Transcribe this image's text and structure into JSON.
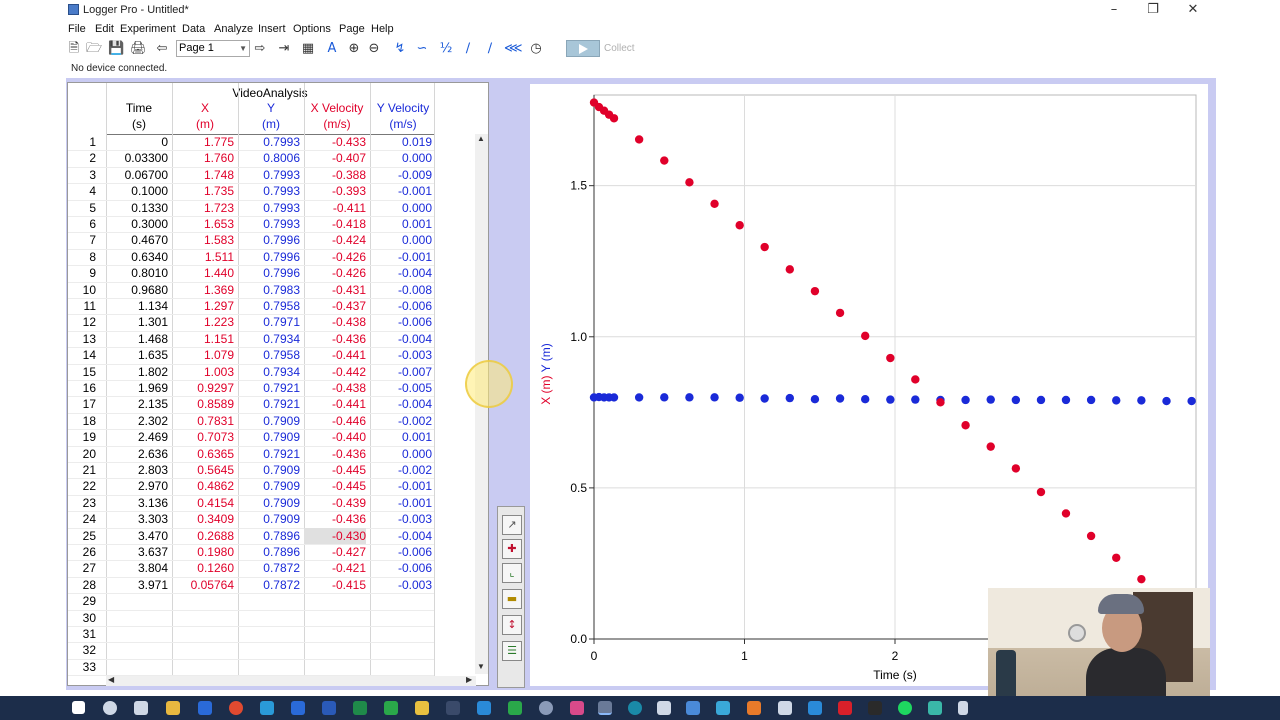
{
  "window": {
    "title": "Logger Pro - Untitled*"
  },
  "menu": [
    "File",
    "Edit",
    "Experiment",
    "Data",
    "Analyze",
    "Insert",
    "Options",
    "Page",
    "Help"
  ],
  "toolbar": {
    "page_label": "Page 1",
    "collect_label": "Collect"
  },
  "status": "No device connected.",
  "table": {
    "dataset": "VideoAnalysis",
    "columns": [
      {
        "name": "Time",
        "unit": "(s)",
        "color": "#000000"
      },
      {
        "name": "X",
        "unit": "(m)",
        "color": "#e0002a"
      },
      {
        "name": "Y",
        "unit": "(m)",
        "color": "#1a2ad8"
      },
      {
        "name": "X Velocity",
        "unit": "(m/s)",
        "color": "#e0002a"
      },
      {
        "name": "Y Velocity",
        "unit": "(m/s)",
        "color": "#1a2ad8"
      }
    ],
    "rows": [
      [
        "0",
        "1.775",
        "0.7993",
        "-0.433",
        "0.019"
      ],
      [
        "0.03300",
        "1.760",
        "0.8006",
        "-0.407",
        "0.000"
      ],
      [
        "0.06700",
        "1.748",
        "0.7993",
        "-0.388",
        "-0.009"
      ],
      [
        "0.1000",
        "1.735",
        "0.7993",
        "-0.393",
        "-0.001"
      ],
      [
        "0.1330",
        "1.723",
        "0.7993",
        "-0.411",
        "0.000"
      ],
      [
        "0.3000",
        "1.653",
        "0.7993",
        "-0.418",
        "0.001"
      ],
      [
        "0.4670",
        "1.583",
        "0.7996",
        "-0.424",
        "0.000"
      ],
      [
        "0.6340",
        "1.511",
        "0.7996",
        "-0.426",
        "-0.001"
      ],
      [
        "0.8010",
        "1.440",
        "0.7996",
        "-0.426",
        "-0.004"
      ],
      [
        "0.9680",
        "1.369",
        "0.7983",
        "-0.431",
        "-0.008"
      ],
      [
        "1.134",
        "1.297",
        "0.7958",
        "-0.437",
        "-0.006"
      ],
      [
        "1.301",
        "1.223",
        "0.7971",
        "-0.438",
        "-0.006"
      ],
      [
        "1.468",
        "1.151",
        "0.7934",
        "-0.436",
        "-0.004"
      ],
      [
        "1.635",
        "1.079",
        "0.7958",
        "-0.441",
        "-0.003"
      ],
      [
        "1.802",
        "1.003",
        "0.7934",
        "-0.442",
        "-0.007"
      ],
      [
        "1.969",
        "0.9297",
        "0.7921",
        "-0.438",
        "-0.005"
      ],
      [
        "2.135",
        "0.8589",
        "0.7921",
        "-0.441",
        "-0.004"
      ],
      [
        "2.302",
        "0.7831",
        "0.7909",
        "-0.446",
        "-0.002"
      ],
      [
        "2.469",
        "0.7073",
        "0.7909",
        "-0.440",
        "0.001"
      ],
      [
        "2.636",
        "0.6365",
        "0.7921",
        "-0.436",
        "0.000"
      ],
      [
        "2.803",
        "0.5645",
        "0.7909",
        "-0.445",
        "-0.002"
      ],
      [
        "2.970",
        "0.4862",
        "0.7909",
        "-0.445",
        "-0.001"
      ],
      [
        "3.136",
        "0.4154",
        "0.7909",
        "-0.439",
        "-0.001"
      ],
      [
        "3.303",
        "0.3409",
        "0.7909",
        "-0.436",
        "-0.003"
      ],
      [
        "3.470",
        "0.2688",
        "0.7896",
        "-0.430",
        "-0.004"
      ],
      [
        "3.637",
        "0.1980",
        "0.7896",
        "-0.427",
        "-0.006"
      ],
      [
        "3.804",
        "0.1260",
        "0.7872",
        "-0.421",
        "-0.006"
      ],
      [
        "3.971",
        "0.05764",
        "0.7872",
        "-0.415",
        "-0.003"
      ]
    ],
    "row_numbers": [
      "1",
      "2",
      "3",
      "4",
      "5",
      "6",
      "7",
      "8",
      "9",
      "10",
      "11",
      "12",
      "13",
      "14",
      "15",
      "16",
      "17",
      "18",
      "19",
      "20",
      "21",
      "22",
      "23",
      "24",
      "25",
      "26",
      "27",
      "28",
      "29",
      "30",
      "31",
      "32",
      "33"
    ],
    "selected_cell": {
      "row": 25,
      "column": "X Velocity"
    }
  },
  "chart_data": {
    "type": "scatter",
    "xlabel": "Time (s)",
    "ylabel_parts": [
      {
        "text": "X (m)",
        "color": "#e0002a"
      },
      {
        "text": "Y (m)",
        "color": "#1a2ad8"
      }
    ],
    "x_ticks": [
      "0",
      "1",
      "2"
    ],
    "y_ticks": [
      "0.0",
      "0.5",
      "1.0",
      "1.5"
    ],
    "xlim": [
      0,
      4.0
    ],
    "ylim": [
      0,
      1.8
    ],
    "grid": true,
    "series": [
      {
        "name": "X",
        "color": "#e0002a",
        "x": [
          0,
          0.033,
          0.067,
          0.1,
          0.133,
          0.3,
          0.467,
          0.634,
          0.801,
          0.968,
          1.134,
          1.301,
          1.468,
          1.635,
          1.802,
          1.969,
          2.135,
          2.302,
          2.469,
          2.636,
          2.803,
          2.97,
          3.136,
          3.303,
          3.47,
          3.637,
          3.804,
          3.971
        ],
        "y": [
          1.775,
          1.76,
          1.748,
          1.735,
          1.723,
          1.653,
          1.583,
          1.511,
          1.44,
          1.369,
          1.297,
          1.223,
          1.151,
          1.079,
          1.003,
          0.9297,
          0.8589,
          0.7831,
          0.7073,
          0.6365,
          0.5645,
          0.4862,
          0.4154,
          0.3409,
          0.2688,
          0.198,
          0.126,
          0.05764
        ]
      },
      {
        "name": "Y",
        "color": "#1a2ad8",
        "x": [
          0,
          0.033,
          0.067,
          0.1,
          0.133,
          0.3,
          0.467,
          0.634,
          0.801,
          0.968,
          1.134,
          1.301,
          1.468,
          1.635,
          1.802,
          1.969,
          2.135,
          2.302,
          2.469,
          2.636,
          2.803,
          2.97,
          3.136,
          3.303,
          3.47,
          3.637,
          3.804,
          3.971
        ],
        "y": [
          0.7993,
          0.8006,
          0.7993,
          0.7993,
          0.7993,
          0.7993,
          0.7996,
          0.7996,
          0.7996,
          0.7983,
          0.7958,
          0.7971,
          0.7934,
          0.7958,
          0.7934,
          0.7921,
          0.7921,
          0.7909,
          0.7909,
          0.7921,
          0.7909,
          0.7909,
          0.7909,
          0.7909,
          0.7896,
          0.7896,
          0.7872,
          0.7872
        ]
      }
    ]
  },
  "icons": {
    "toolbar": [
      "new-file-icon",
      "open-icon",
      "save-icon",
      "print-icon",
      "back-icon",
      "forward-icon",
      "page-next-icon",
      "calculator-icon",
      "autoscale-icon",
      "zoom-in-icon",
      "zoom-out-icon",
      "examine-icon",
      "tangent-icon",
      "integral-icon",
      "linear-fit-icon",
      "curve-fit-icon",
      "stopwatch-icon",
      "play-icon"
    ],
    "video_tools": [
      "select-arrow-icon",
      "add-point-icon",
      "set-origin-icon",
      "set-scale-icon",
      "photo-distance-icon",
      "video-options-icon"
    ]
  }
}
